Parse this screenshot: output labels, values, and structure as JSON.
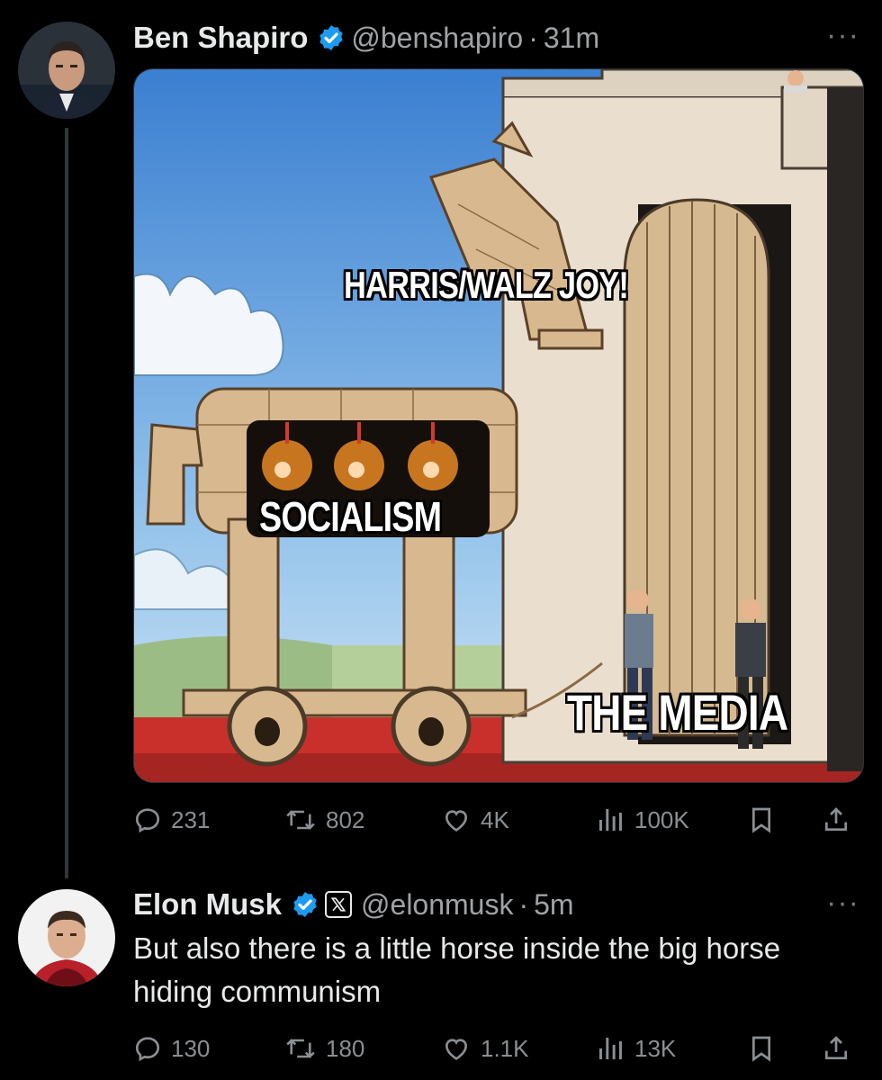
{
  "tweet": {
    "author_name": "Ben Shapiro",
    "handle": "@benshapiro",
    "separator": "·",
    "time": "31m",
    "more": "···",
    "meme_labels": {
      "horse_head": "HARRIS/WALZ JOY!",
      "horse_belly": "SOCIALISM",
      "gate_people": "THE MEDIA"
    },
    "stats": {
      "replies": "231",
      "reposts": "802",
      "likes": "4K",
      "views": "100K"
    }
  },
  "reply": {
    "author_name": "Elon Musk",
    "handle": "@elonmusk",
    "separator": "·",
    "time": "5m",
    "more": "···",
    "text": "But also there is a little horse inside the big horse hiding communism",
    "stats": {
      "replies": "130",
      "reposts": "180",
      "likes": "1.1K",
      "views": "13K"
    }
  },
  "colors": {
    "background": "#000000",
    "verified_blue": "#1d9bf0",
    "muted_text": "#71767b"
  }
}
